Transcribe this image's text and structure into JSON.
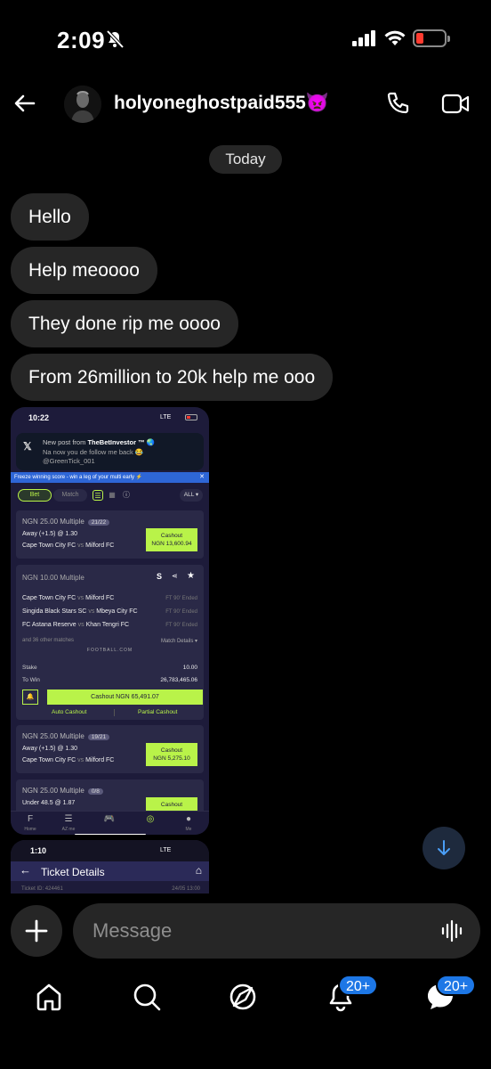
{
  "status_bar": {
    "time": "2:09"
  },
  "header": {
    "username": "holyoneghostpaid555👿"
  },
  "date_divider": "Today",
  "messages": [
    {
      "text": "Hello"
    },
    {
      "text": "Help meoooo"
    },
    {
      "text": "They done rip me oooo"
    },
    {
      "text": "From 26million to 20k help me ooo"
    }
  ],
  "shared_screenshot": {
    "status_time": "10:22",
    "network": "LTE",
    "notification": {
      "line1_prefix": "New post from",
      "line1_author": "TheBetInvestor ™ 🌏",
      "line2": "Na now you de follow me back 😂",
      "line3": "@GreenTick_001"
    },
    "promo_banner": "Freeze winning score - win a leg of your multi early ⚡",
    "tabs": {
      "bet": "Bet",
      "match": "Match",
      "filter": "ALL ▾"
    },
    "bet1": {
      "title": "NGN 25.00  Multiple",
      "count": "21/22",
      "pick": "Away (+1.5) @ 1.30",
      "home": "Cape Town City FC",
      "vs": "vs",
      "away": "Milford FC",
      "cashout_label": "Cashout",
      "cashout_amount": "NGN 13,600.94"
    },
    "bet2": {
      "title": "NGN 10.00  Multiple",
      "matches": [
        {
          "home": "Cape Town City FC",
          "away": "Milford FC",
          "status": "FT 90' Ended"
        },
        {
          "home": "Singida Black Stars SC",
          "away": "Mbeya City FC",
          "status": "FT 90' Ended"
        },
        {
          "home": "FC Astana Reserve",
          "away": "Khan Tengri FC",
          "status": "FT 90' Ended"
        }
      ],
      "more_text": "and 36 other matches",
      "details_link": "Match Details ▾",
      "watermark": "FOOTBALL.COM",
      "stake_label": "Stake",
      "stake_value": "10.00",
      "towin_label": "To Win",
      "towin_value": "26,783,465.06",
      "cashout_button": "Cashout NGN 65,491.07",
      "auto_cashout": "Auto Cashout",
      "partial_cashout": "Partial Cashout"
    },
    "bet3": {
      "title": "NGN 25.00  Multiple",
      "count": "19/21",
      "pick": "Away (+1.5) @ 1.30",
      "home": "Cape Town City FC",
      "vs": "vs",
      "away": "Milford FC",
      "cashout_label": "Cashout",
      "cashout_amount": "NGN 5,275.10"
    },
    "bet4": {
      "title": "NGN 25.00  Multiple",
      "count": "0/8",
      "pick": "Under 48.5 @ 1.87",
      "cashout_label": "Cashout"
    },
    "nav": [
      {
        "label": "Home"
      },
      {
        "label": "AZ me"
      },
      {
        "label": ""
      },
      {
        "label": ""
      },
      {
        "label": "Me"
      }
    ]
  },
  "shared_screenshot_2": {
    "status_time": "1:10",
    "network": "LTE",
    "title": "Ticket Details",
    "ticket_id": "Ticket ID: 424461",
    "ticket_date": "24/05 13:00"
  },
  "composer": {
    "placeholder": "Message"
  },
  "bottom_nav": {
    "activity_badge": "20+",
    "messages_badge": "20+"
  },
  "colors": {
    "bubble": "#262626",
    "accent_lime": "#b9f349",
    "badge_blue": "#1d77e6"
  }
}
